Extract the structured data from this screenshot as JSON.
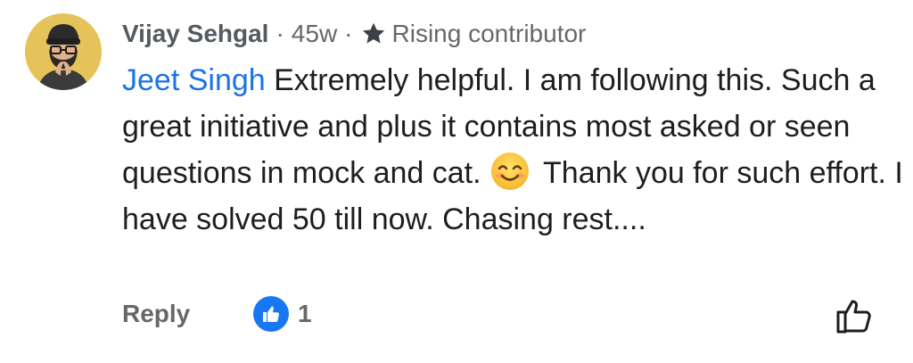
{
  "comment": {
    "author": "Vijay Sehgal",
    "age": "45w",
    "separator": "·",
    "badge_icon": "star-icon",
    "badge": "Rising contributor",
    "mention": "Jeet Singh",
    "text_part1": " Extremely helpful. I am following this. Such a great initiative and plus it contains most asked or seen questions in mock and cat. ",
    "emoji": "smiling-face-emoji",
    "text_part2": "Thank you for such effort. I have solved 50 till now. Chasing rest...."
  },
  "actions": {
    "reply_label": "Reply",
    "like_count": "1",
    "like_icon": "thumbs-up-icon"
  },
  "colors": {
    "mention": "#1a73e8",
    "like_badge": "#1877f2",
    "avatar_bg": "#e6c35a",
    "meta_text": "#65676b"
  }
}
